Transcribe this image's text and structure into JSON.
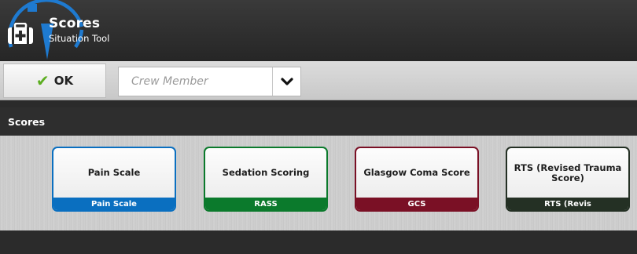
{
  "header": {
    "title": "Scores",
    "subtitle": "Situation Tool",
    "icon": "medical-kit-icon"
  },
  "toolbar": {
    "ok_label": "OK",
    "crew_placeholder": "Crew Member"
  },
  "section": {
    "title": "Scores"
  },
  "cards": [
    {
      "title": "Pain Scale",
      "footer": "Pain Scale",
      "color": "#0a6fc0"
    },
    {
      "title": "Sedation Scoring",
      "footer": "RASS",
      "color": "#0b7a2c"
    },
    {
      "title": "Glasgow Coma Score",
      "footer": "GCS",
      "color": "#7a1025"
    },
    {
      "title": "RTS (Revised Trauma Score)",
      "footer": "RTS (Revis",
      "color": "#243024"
    }
  ],
  "colors": {
    "accent_blue": "#1e7ad0",
    "check_green": "#5cae21"
  }
}
